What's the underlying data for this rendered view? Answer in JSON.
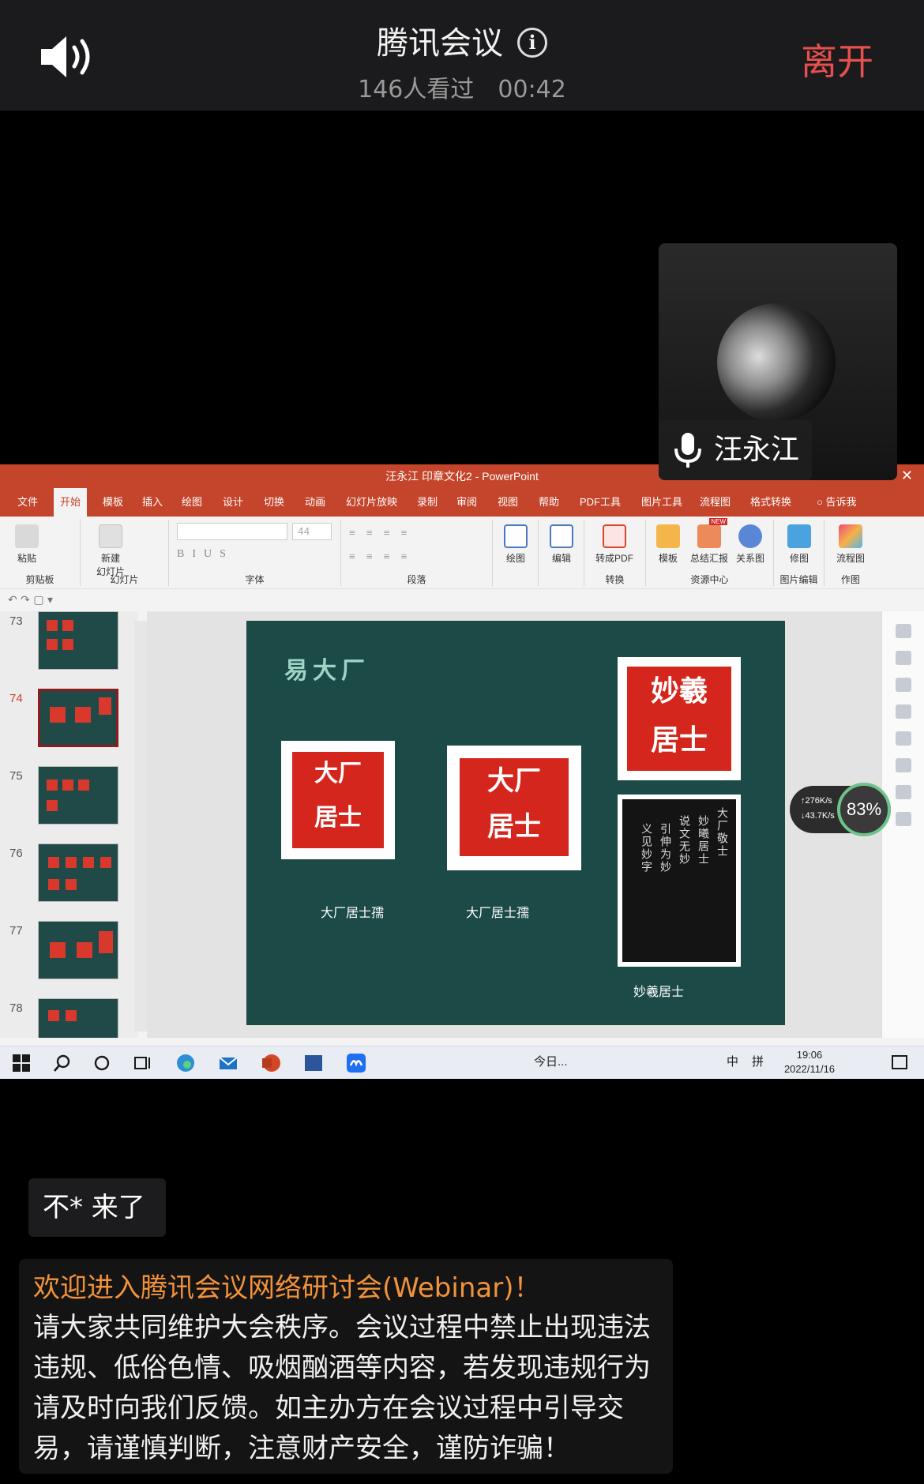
{
  "header": {
    "title": "腾讯会议",
    "viewers": "146人看过",
    "duration": "00:42",
    "leave_label": "离开"
  },
  "participant": {
    "name": "汪永江"
  },
  "powerpoint": {
    "window_title": "汪永江 印章文化2 - PowerPoint",
    "tabs": [
      "文件",
      "开始",
      "模板",
      "插入",
      "绘图",
      "设计",
      "切换",
      "动画",
      "幻灯片放映",
      "录制",
      "审阅",
      "视图",
      "帮助",
      "PDF工具",
      "图片工具",
      "流程图",
      "格式转换",
      "告诉我"
    ],
    "active_tab": "开始",
    "ribbon": {
      "paste": "粘贴",
      "clipboard": "剪贴板",
      "new_slide": "新建\n幻灯片",
      "slides": "幻灯片",
      "font_size": "44",
      "font": "字体",
      "paragraph": "段落",
      "draw": "绘图",
      "edit": "编辑",
      "to_pdf": "转成PDF",
      "convert": "转换",
      "template": "模板",
      "summary": "总结汇报",
      "relation": "关系图",
      "resource_center": "资源中心",
      "new_badge": "NEW",
      "retouch": "修图",
      "image_edit": "图片编辑",
      "flowchart": "流程图",
      "drawing": "作图"
    },
    "thumbnails": [
      "73",
      "74",
      "75",
      "76",
      "77",
      "78"
    ],
    "selected_thumbnail": "74",
    "slide": {
      "heading": "易大厂",
      "caption_1": "大厂居士孺",
      "caption_2": "大厂居士孺",
      "caption_3": "妙羲居士"
    },
    "network": {
      "up": "276K/s",
      "down": "43.7K/s",
      "percent": "83%"
    },
    "taskbar": {
      "today": "今日...",
      "ime": "中",
      "pinyin": "拼",
      "time": "19:06",
      "date": "2022/11/16"
    }
  },
  "chat": {
    "message": "不* 来了",
    "notice_title": "欢迎进入腾讯会议网络研讨会(Webinar)！",
    "notice_body": "请大家共同维护大会秩序。会议过程中禁止出现违法违规、低俗色情、吸烟酗酒等内容，若发现违规行为请及时向我们反馈。如主办方在会议过程中引导交易，请谨慎判断，注意财产安全，谨防诈骗！"
  }
}
